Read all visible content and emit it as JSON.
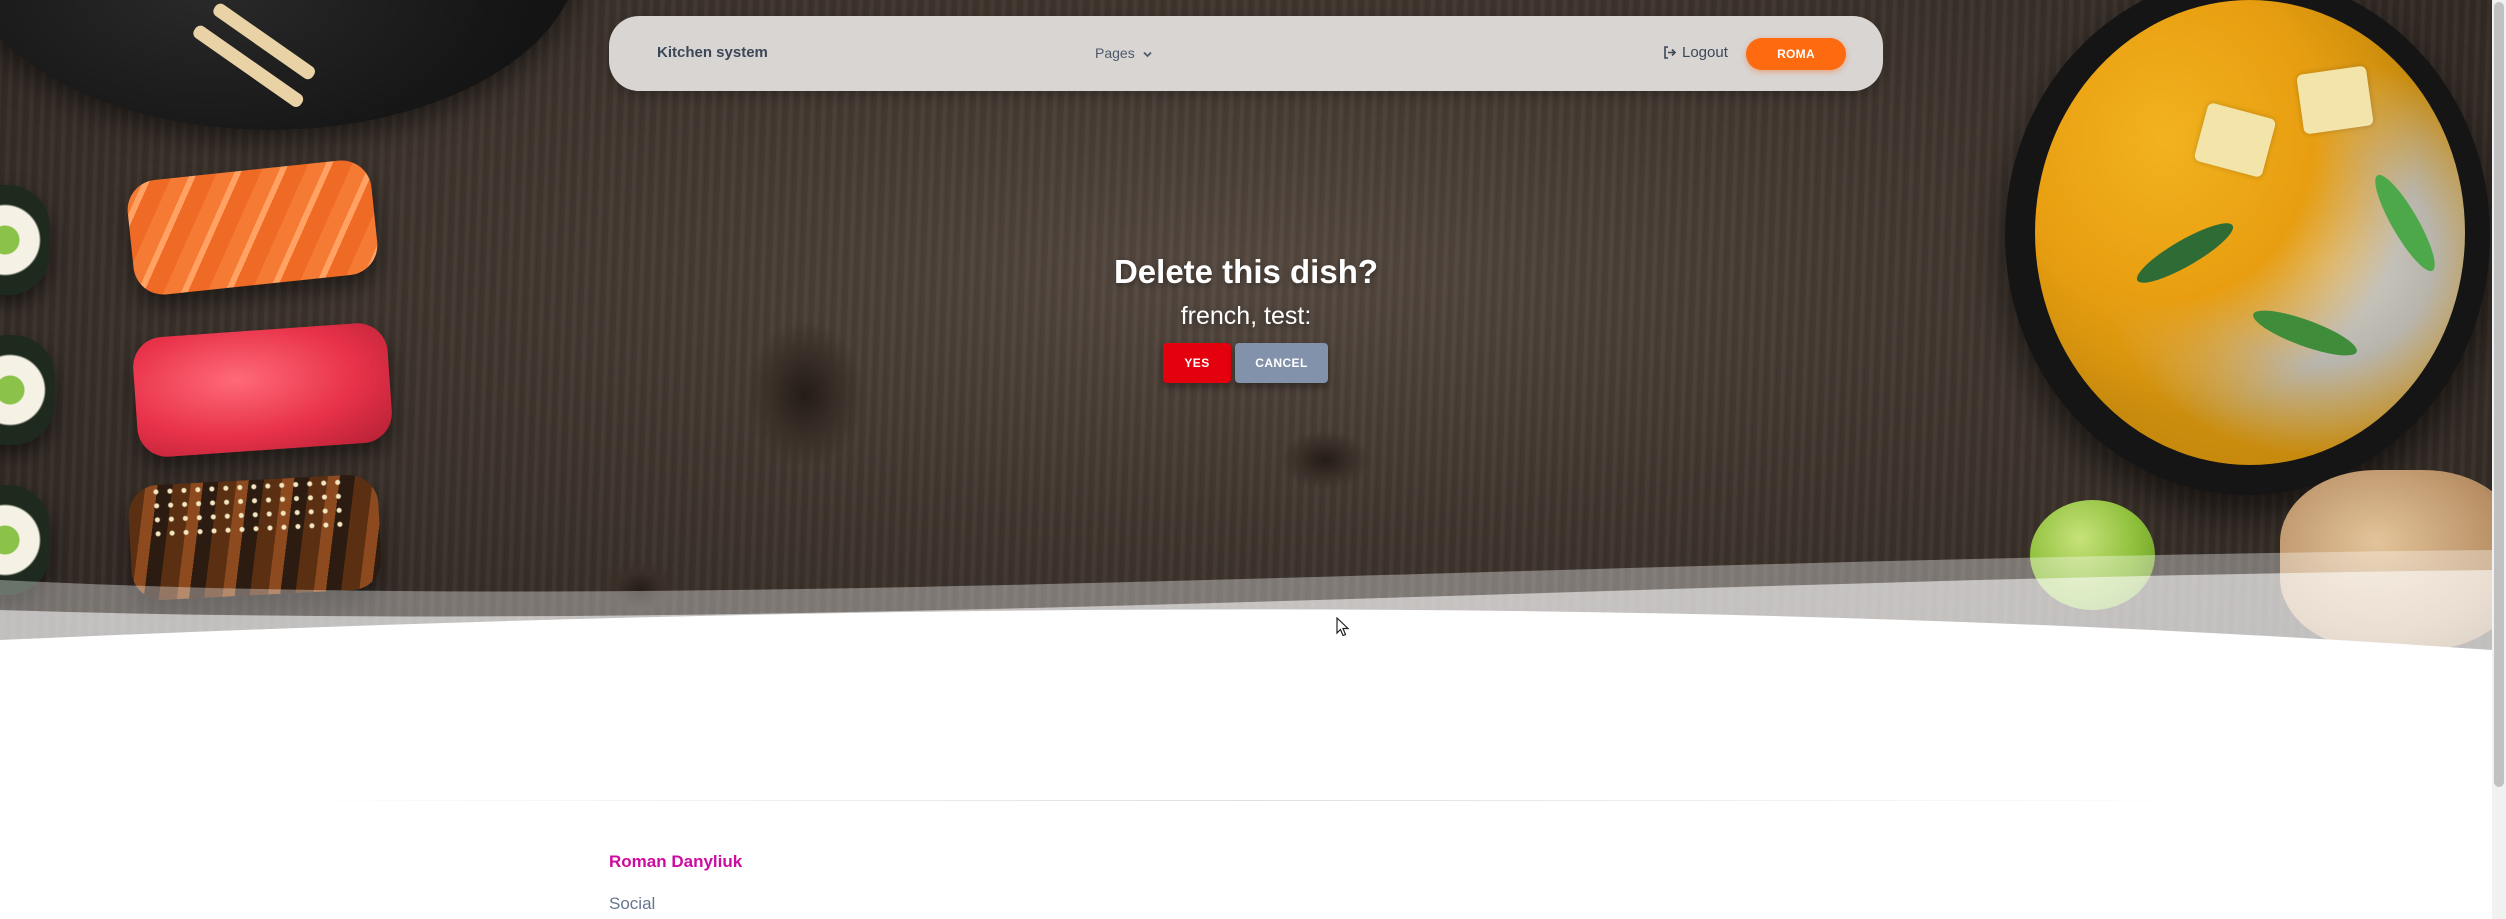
{
  "navbar": {
    "brand": "Kitchen system",
    "pages_label": "Pages",
    "logout_label": "Logout",
    "user_button_label": "ROMA"
  },
  "dialog": {
    "question": "Delete this dish?",
    "dish_name": "french, test:",
    "yes_label": "YES",
    "cancel_label": "CANCEL"
  },
  "footer": {
    "author": "Roman Danyliuk",
    "social_label": "Social"
  },
  "colors": {
    "accent_orange": "#fd6a0f",
    "danger_red": "#e5000e",
    "secondary_gray": "#8392ab",
    "author_pink": "#cb0c9f"
  },
  "icons": {
    "logout": "sign-out-icon",
    "pages_dropdown": "chevron-down-icon"
  }
}
